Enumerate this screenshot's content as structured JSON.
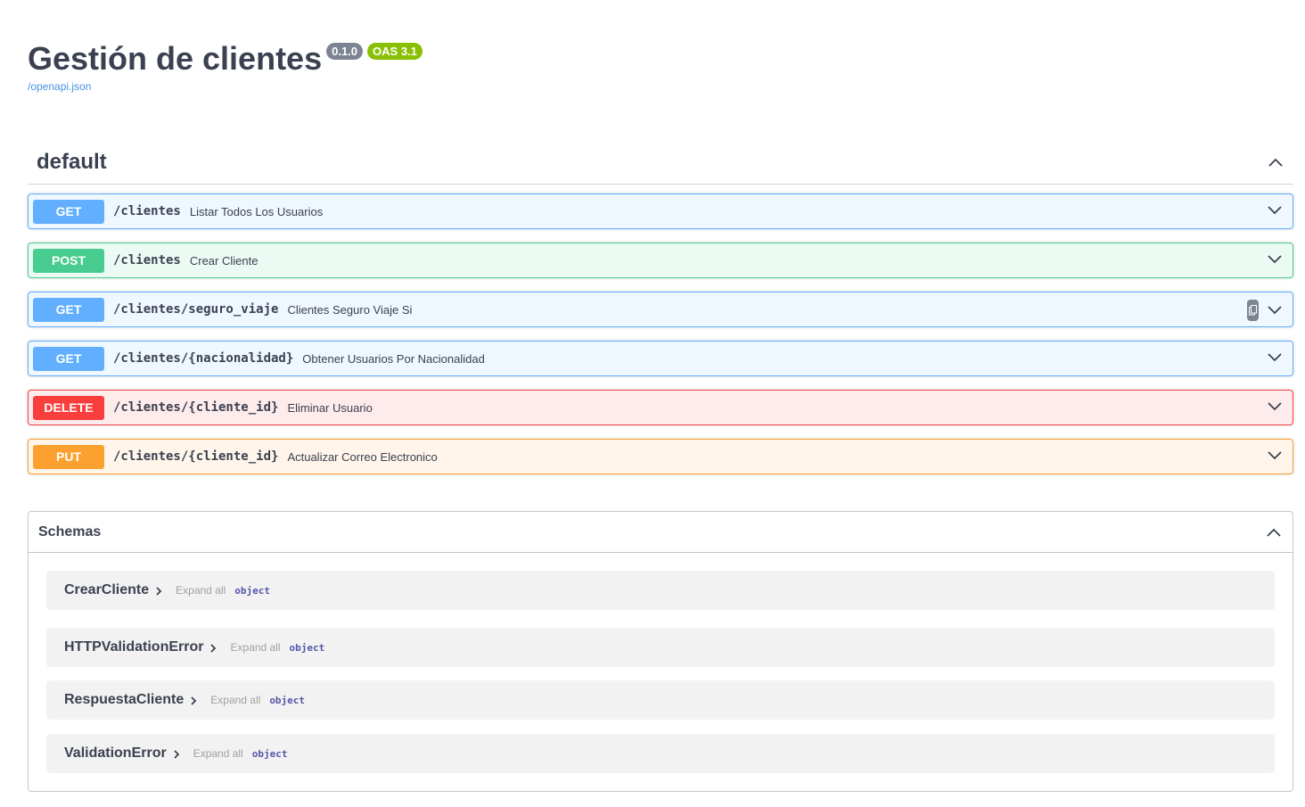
{
  "info": {
    "title": "Gestión de clientes",
    "version": "0.1.0",
    "oas": "OAS 3.1",
    "spec_link": "/openapi.json"
  },
  "tag": {
    "name": "default",
    "operations": [
      {
        "method": "GET",
        "path": "/clientes",
        "summary": "Listar Todos Los Usuarios"
      },
      {
        "method": "POST",
        "path": "/clientes",
        "summary": "Crear Cliente"
      },
      {
        "method": "GET",
        "path": "/clientes/seguro_viaje",
        "summary": "Clientes Seguro Viaje Si"
      },
      {
        "method": "GET",
        "path": "/clientes/{nacionalidad}",
        "summary": "Obtener Usuarios Por Nacionalidad"
      },
      {
        "method": "DELETE",
        "path": "/clientes/{cliente_id}",
        "summary": "Eliminar Usuario"
      },
      {
        "method": "PUT",
        "path": "/clientes/{cliente_id}",
        "summary": "Actualizar Correo Electronico"
      }
    ]
  },
  "schemas": {
    "title": "Schemas",
    "models": [
      {
        "name": "CrearCliente",
        "expand": "Expand all",
        "type": "object"
      },
      {
        "name": "HTTPValidationError",
        "expand": "Expand all",
        "type": "object"
      },
      {
        "name": "RespuestaCliente",
        "expand": "Expand all",
        "type": "object"
      },
      {
        "name": "ValidationError",
        "expand": "Expand all",
        "type": "object"
      }
    ]
  },
  "colors": {
    "get": "#61affe",
    "post": "#49cc90",
    "delete": "#f93e3e",
    "put": "#fca130",
    "link": "#4990e2",
    "version_badge": "#7d8492",
    "oas_badge": "#89bf04"
  },
  "icons": {
    "collapse": "chevron-up-icon",
    "expand": "chevron-down-icon",
    "copy": "copy-icon",
    "model_expand": "chevron-right-icon"
  }
}
